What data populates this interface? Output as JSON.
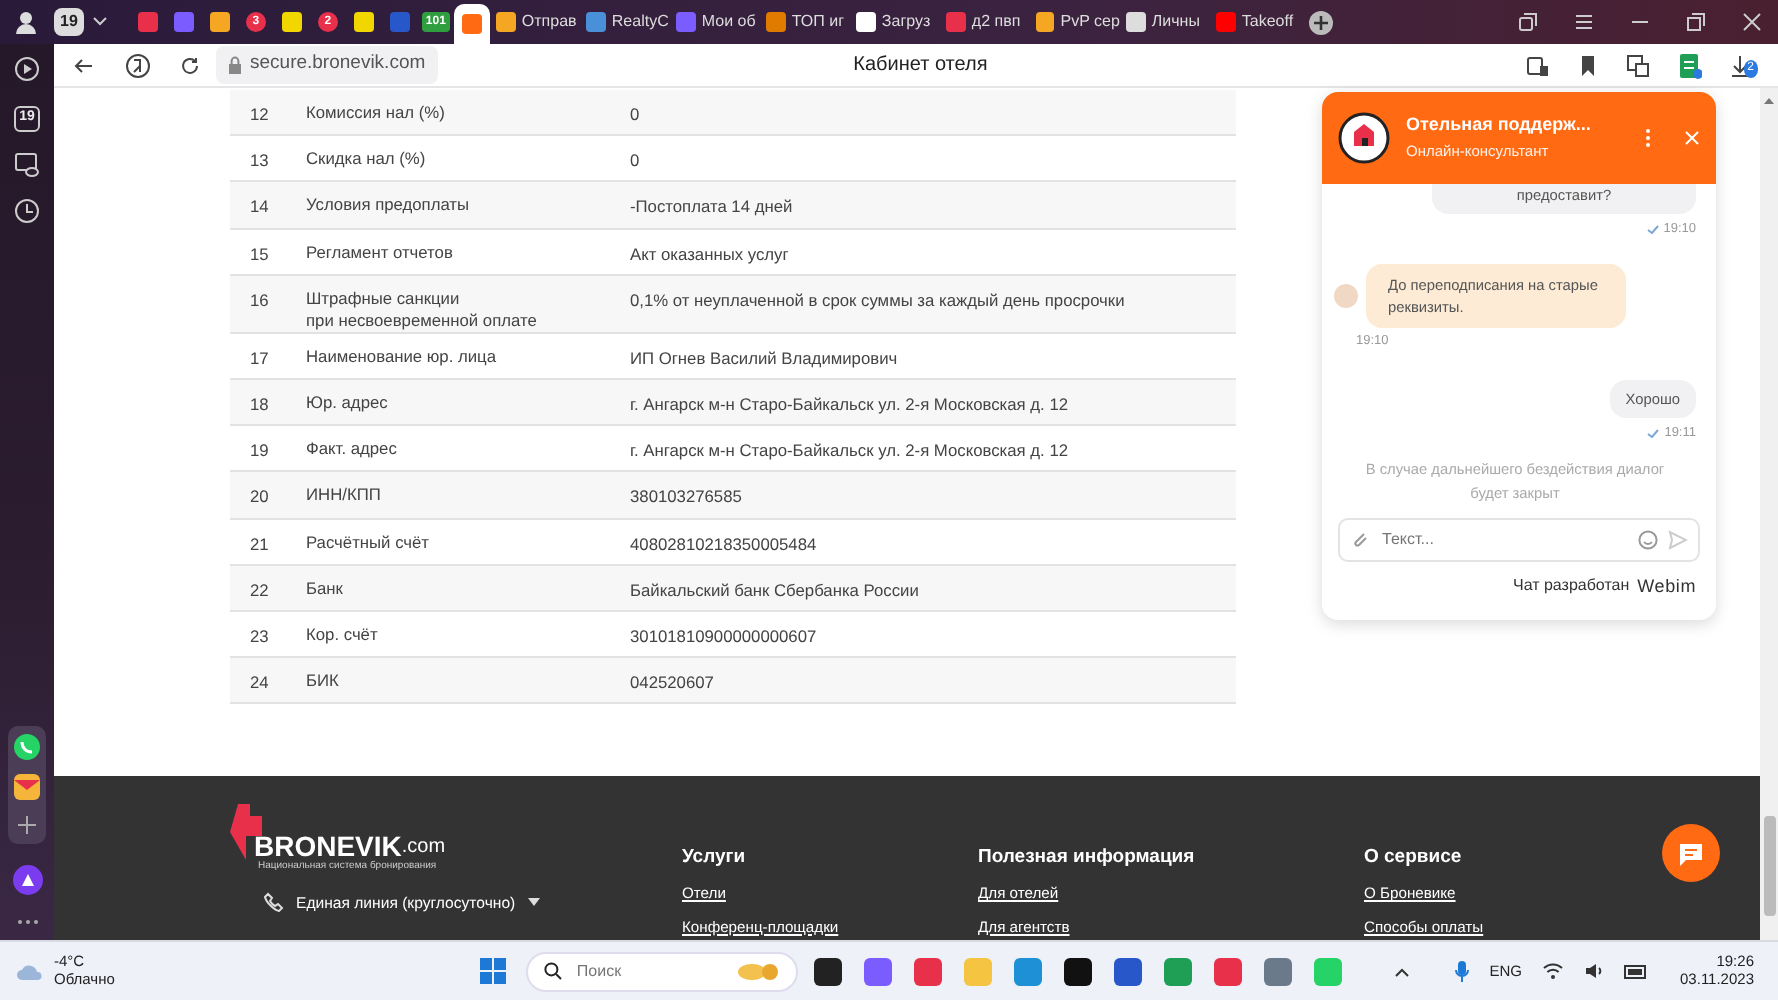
{
  "browser": {
    "profile_badge": "19",
    "tabs": [
      {
        "color": "#e8304a",
        "selected": false
      },
      {
        "color": "#7b5cff",
        "selected": false
      },
      {
        "color": "#f5a623",
        "selected": false
      },
      {
        "color": "#e8304a",
        "badge": "3",
        "selected": false
      },
      {
        "color": "#f2d600",
        "selected": false
      },
      {
        "color": "#e8304a",
        "badge": "2",
        "selected": false
      },
      {
        "color": "#f2d600",
        "selected": false
      },
      {
        "color": "#2857c9",
        "selected": false
      },
      {
        "color": "#2e9e3e",
        "badge": "101",
        "selected": false
      },
      {
        "color": "#ff6a13",
        "selected": true
      },
      {
        "label": "Отправ",
        "color": "#f5a623",
        "selected": false
      },
      {
        "label": "RealtyC",
        "color": "#4a90d9",
        "selected": false
      },
      {
        "label": "Мои об",
        "color": "#7b5cff",
        "selected": false
      },
      {
        "label": "ТОП иг",
        "color": "#e07b00",
        "selected": false
      },
      {
        "label": "Загруз",
        "color": "#ffffff",
        "selected": false
      },
      {
        "label": "д2 пвп",
        "color": "#e8304a",
        "selected": false
      },
      {
        "label": "PvP сер",
        "color": "#f5a623",
        "selected": false
      },
      {
        "label": "Личны",
        "color": "#dddddd",
        "selected": false
      },
      {
        "label": "Takeoff",
        "color": "#ff0000",
        "selected": false
      }
    ],
    "address": "secure.bronevik.com",
    "page_title": "Кабинет отеля",
    "download_badge": "2"
  },
  "sidebar": {
    "badge": "19"
  },
  "table": {
    "rows": [
      {
        "num": "12",
        "name": "Комиссия нал (%)",
        "value": "0"
      },
      {
        "num": "13",
        "name": "Скидка нал (%)",
        "value": "0"
      },
      {
        "num": "14",
        "name": "Условия предоплаты",
        "value": "-Постоплата 14 дней"
      },
      {
        "num": "15",
        "name": "Регламент отчетов",
        "value": "Акт оказанных услуг"
      },
      {
        "num": "16",
        "name": "Штрафные санкции\nпри несвоевременной оплате",
        "value": "0,1% от неуплаченной в срок суммы за каждый день просрочки"
      },
      {
        "num": "17",
        "name": "Наименование юр. лица",
        "value": "ИП Огнев Василий Владимирович"
      },
      {
        "num": "18",
        "name": "Юр. адрес",
        "value": "г. Ангарск м-н Старо-Байкальск ул. 2-я Московская д. 12"
      },
      {
        "num": "19",
        "name": "Факт. адрес",
        "value": "г. Ангарск м-н Старо-Байкальск ул. 2-я Московская д. 12"
      },
      {
        "num": "20",
        "name": "ИНН/КПП",
        "value": "380103276585"
      },
      {
        "num": "21",
        "name": "Расчётный счёт",
        "value": "40802810218350005484"
      },
      {
        "num": "22",
        "name": "Банк",
        "value": "Байкальский банк Сбербанка России"
      },
      {
        "num": "23",
        "name": "Кор. счёт",
        "value": "30101810900000000607"
      },
      {
        "num": "24",
        "name": "БИК",
        "value": "042520607"
      }
    ]
  },
  "chat": {
    "title": "Отельная поддерж...",
    "subtitle": "Онлайн-консультант",
    "messages": [
      {
        "kind": "visitor",
        "text": "предоставит?",
        "time": "19:10"
      },
      {
        "kind": "operator",
        "text": "До переподписания на старые реквизиты.",
        "time": "19:10"
      },
      {
        "kind": "visitor",
        "text": "Хорошо",
        "time": "19:11"
      },
      {
        "kind": "system",
        "text": "В случае дальнейшего бездействия диалог будет закрыт"
      }
    ],
    "input_placeholder": "Текст...",
    "credit": "Чат разработан",
    "brand": "Webim"
  },
  "footer": {
    "logo": "BRONEVIK",
    "logo_suffix": ".com",
    "tagline": "Национальная система бронирования",
    "phone_label": "Единая линия (круглосуточно)",
    "columns": [
      {
        "title": "Услуги",
        "links": [
          "Отели",
          "Конференц-площадки"
        ]
      },
      {
        "title": "Полезная информация",
        "links": [
          "Для отелей",
          "Для агентств"
        ]
      },
      {
        "title": "О сервисе",
        "links": [
          "О Броневике",
          "Способы оплаты"
        ]
      }
    ]
  },
  "taskbar": {
    "temperature": "-4°C",
    "weather": "Облачно",
    "search_placeholder": "Поиск",
    "apps": [
      {
        "color": "#222222"
      },
      {
        "color": "#7b5cff"
      },
      {
        "color": "#e8304a"
      },
      {
        "color": "#f5c542"
      },
      {
        "color": "#1e90d6"
      },
      {
        "color": "#111111"
      },
      {
        "color": "#2857c9"
      },
      {
        "color": "#1f9e55"
      },
      {
        "color": "#e8304a"
      },
      {
        "color": "#6a7a8a"
      },
      {
        "color": "#25d366"
      }
    ],
    "language": "ENG",
    "time": "19:26",
    "date": "03.11.2023"
  }
}
